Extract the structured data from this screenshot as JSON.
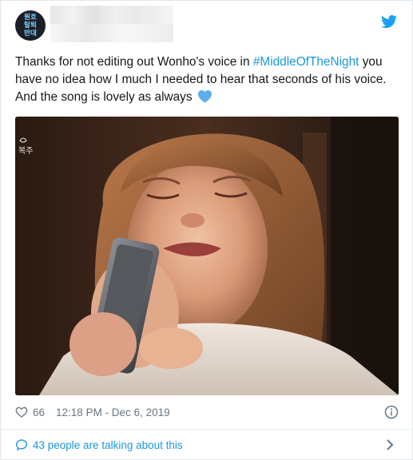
{
  "author": {
    "avatar_text": "원호\n탈퇴\n반대"
  },
  "tweet": {
    "text_before": "Thanks for not editing out Wonho's voice in ",
    "hashtag": "#MiddleOfTheNight",
    "text_after": " you have no idea how I much I needed to hear that seconds of his voice. And the song is lovely as always ",
    "emoji": "blue-heart-icon"
  },
  "media": {
    "kind": "image",
    "overlay_text": "복주"
  },
  "meta": {
    "like_count": "66",
    "timestamp": "12:18 PM - Dec 6, 2019"
  },
  "conversation": {
    "label": "43 people are talking about this"
  },
  "icons": {
    "platform": "twitter-bird-icon",
    "like": "heart-outline-icon",
    "info": "info-icon",
    "talk": "speech-bubble-icon",
    "chevron": "chevron-right-icon"
  },
  "colors": {
    "link": "#1b95e0",
    "text": "#14171a",
    "muted": "#657786",
    "heart": "#5dadec"
  }
}
